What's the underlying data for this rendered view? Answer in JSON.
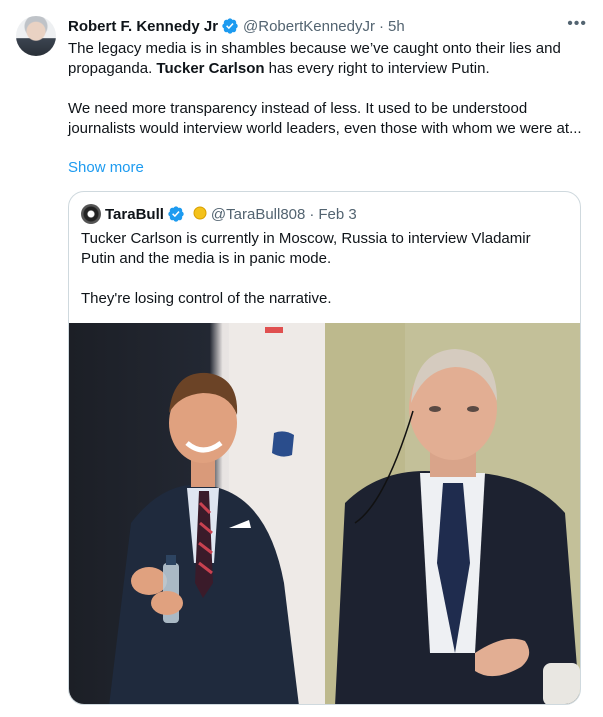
{
  "author": {
    "name": "Robert F. Kennedy Jr",
    "handle": "@RobertKennedyJr",
    "separator": "·",
    "time": "5h"
  },
  "tweet": {
    "para1_a": "The legacy media is in shambles because we’ve caught onto their lies and propaganda. ",
    "para1_bold": "Tucker Carlson",
    "para1_b": " has every right to interview Putin.",
    "para2": "We need more transparency instead of less. It used to be understood journalists would interview world leaders, even those with whom we were at...",
    "show_more": "Show more"
  },
  "quoted": {
    "name": "TaraBull",
    "handle": "@TaraBull808",
    "separator": "·",
    "date": "Feb 3",
    "line1": "Tucker Carlson is currently in Moscow, Russia to interview Vladamir Putin and the media is in panic mode.",
    "line2": "They're losing control of the narrative."
  },
  "colors": {
    "verified": "#1d9bf0",
    "link": "#1d9bf0",
    "muted": "#536471",
    "border": "#cfd9de"
  },
  "icons": {
    "verified": "verified-badge-icon",
    "more": "more-options-icon",
    "emoji": "yellow-circle-emoji"
  }
}
